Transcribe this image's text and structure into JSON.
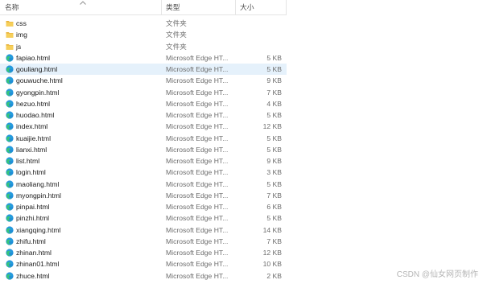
{
  "columns": {
    "name": "名称",
    "type": "类型",
    "size": "大小"
  },
  "files": [
    {
      "name": "css",
      "type": "文件夹",
      "size": "",
      "icon": "folder-icon"
    },
    {
      "name": "img",
      "type": "文件夹",
      "size": "",
      "icon": "folder-icon"
    },
    {
      "name": "js",
      "type": "文件夹",
      "size": "",
      "icon": "folder-icon"
    },
    {
      "name": "fapiao.html",
      "type": "Microsoft Edge HT...",
      "size": "5 KB",
      "icon": "edge-html-icon"
    },
    {
      "name": "gouliang.html",
      "type": "Microsoft Edge HT...",
      "size": "5 KB",
      "icon": "edge-html-icon",
      "selected": true
    },
    {
      "name": "gouwuche.html",
      "type": "Microsoft Edge HT...",
      "size": "9 KB",
      "icon": "edge-html-icon"
    },
    {
      "name": "gyongpin.html",
      "type": "Microsoft Edge HT...",
      "size": "7 KB",
      "icon": "edge-html-icon"
    },
    {
      "name": "hezuo.html",
      "type": "Microsoft Edge HT...",
      "size": "4 KB",
      "icon": "edge-html-icon"
    },
    {
      "name": "huodao.html",
      "type": "Microsoft Edge HT...",
      "size": "5 KB",
      "icon": "edge-html-icon"
    },
    {
      "name": "index.html",
      "type": "Microsoft Edge HT...",
      "size": "12 KB",
      "icon": "edge-html-icon"
    },
    {
      "name": "kuaijie.html",
      "type": "Microsoft Edge HT...",
      "size": "5 KB",
      "icon": "edge-html-icon"
    },
    {
      "name": "lianxi.html",
      "type": "Microsoft Edge HT...",
      "size": "5 KB",
      "icon": "edge-html-icon"
    },
    {
      "name": "list.html",
      "type": "Microsoft Edge HT...",
      "size": "9 KB",
      "icon": "edge-html-icon"
    },
    {
      "name": "login.html",
      "type": "Microsoft Edge HT...",
      "size": "3 KB",
      "icon": "edge-html-icon"
    },
    {
      "name": "maoliang.html",
      "type": "Microsoft Edge HT...",
      "size": "5 KB",
      "icon": "edge-html-icon"
    },
    {
      "name": "myongpin.html",
      "type": "Microsoft Edge HT...",
      "size": "7 KB",
      "icon": "edge-html-icon"
    },
    {
      "name": "pinpai.html",
      "type": "Microsoft Edge HT...",
      "size": "6 KB",
      "icon": "edge-html-icon"
    },
    {
      "name": "pinzhi.html",
      "type": "Microsoft Edge HT...",
      "size": "5 KB",
      "icon": "edge-html-icon"
    },
    {
      "name": "xiangqing.html",
      "type": "Microsoft Edge HT...",
      "size": "14 KB",
      "icon": "edge-html-icon"
    },
    {
      "name": "zhifu.html",
      "type": "Microsoft Edge HT...",
      "size": "7 KB",
      "icon": "edge-html-icon"
    },
    {
      "name": "zhinan.html",
      "type": "Microsoft Edge HT...",
      "size": "12 KB",
      "icon": "edge-html-icon"
    },
    {
      "name": "zhinan01.html",
      "type": "Microsoft Edge HT...",
      "size": "10 KB",
      "icon": "edge-html-icon"
    },
    {
      "name": "zhuce.html",
      "type": "Microsoft Edge HT...",
      "size": "2 KB",
      "icon": "edge-html-icon"
    }
  ],
  "watermark": "CSDN @仙女网页制作",
  "colors": {
    "selected_row": "#e5f1fb",
    "folder": "#f4c74f",
    "edge_blue": "#1f8fd6",
    "edge_green": "#37c47a"
  }
}
